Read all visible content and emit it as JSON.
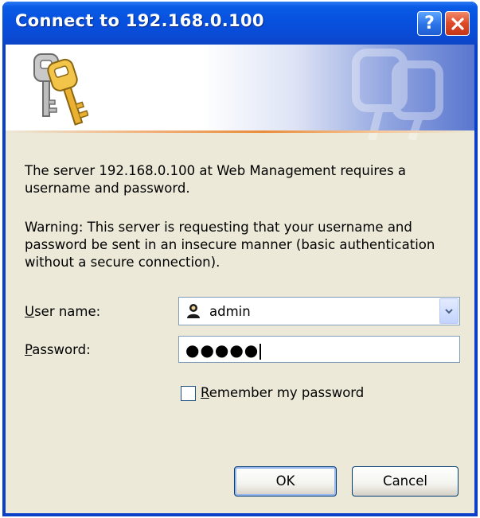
{
  "window": {
    "title": "Connect to 192.168.0.100",
    "help_glyph": "?",
    "close_icon": "close-icon"
  },
  "banner": {
    "icon": "keys-icon"
  },
  "message": {
    "line1": "The server 192.168.0.100 at Web Management requires a username and password.",
    "warning": "Warning: This server is requesting that your username and password be sent in an insecure manner (basic authentication without a secure connection)."
  },
  "form": {
    "username": {
      "label_prefix": "",
      "label_accel": "U",
      "label_rest": "ser name:",
      "value": "admin",
      "icon": "user-icon"
    },
    "password": {
      "label_accel": "P",
      "label_rest": "assword:",
      "masked_value": "●●●●●"
    },
    "remember": {
      "label_accel": "R",
      "label_rest": "emember my password",
      "checked": false
    }
  },
  "buttons": {
    "ok": "OK",
    "cancel": "Cancel"
  },
  "colors": {
    "title_bar": "#0751df",
    "client_bg": "#ece9d8",
    "close_red": "#de4a27"
  }
}
